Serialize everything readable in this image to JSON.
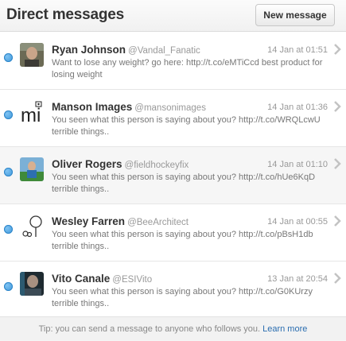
{
  "header": {
    "title": "Direct messages",
    "new_message_label": "New message"
  },
  "messages": [
    {
      "name": "Ryan Johnson",
      "handle": "@Vandal_Fanatic",
      "time": "14 Jan at 01:51",
      "text": "Want to lose any weight? go here: http://t.co/eMTiCcd best product for losing weight",
      "avatar_icon": "photo-avatar-icon"
    },
    {
      "name": "Manson Images",
      "handle": "@mansonimages",
      "time": "14 Jan at 01:36",
      "text": "You seen what this person is saying about you? http://t.co/WRQLcwU terrible things..",
      "avatar_icon": "mi-logo-icon",
      "avatar_text": "mi"
    },
    {
      "name": "Oliver Rogers",
      "handle": "@fieldhockeyfix",
      "time": "14 Jan at 01:10",
      "text": "You seen what this person is saying about you? http://t.co/hUe6KqD terrible things..",
      "avatar_icon": "photo-avatar-icon"
    },
    {
      "name": "Wesley Farren",
      "handle": "@BeeArchitect",
      "time": "14 Jan at 00:55",
      "text": "You seen what this person is saying about you? http://t.co/pBsH1db terrible things..",
      "avatar_icon": "tree-logo-icon"
    },
    {
      "name": "Vito Canale",
      "handle": "@ESIVito",
      "time": "13 Jan at 20:54",
      "text": "You seen what this person is saying about you? http://t.co/G0KUrzy terrible things..",
      "avatar_icon": "photo-avatar-icon"
    }
  ],
  "footer": {
    "tip": "Tip: you can send a message to anyone who follows you.",
    "link": "Learn more"
  },
  "colors": {
    "unread_dot": "#3a95d8",
    "link": "#2a6db0"
  }
}
